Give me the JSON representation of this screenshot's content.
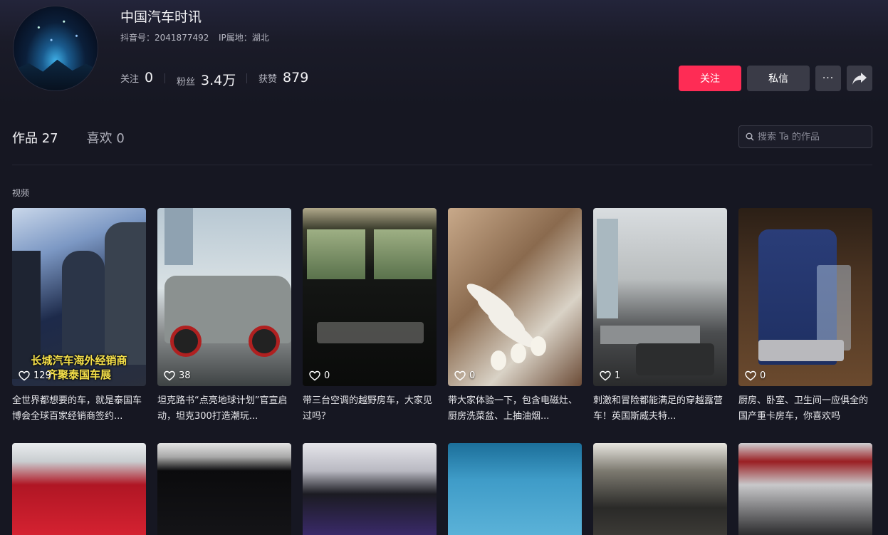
{
  "profile": {
    "name": "中国汽车时讯",
    "douyin_id_label": "抖音号：",
    "douyin_id": "2041877492",
    "ip_label": "IP属地：",
    "ip": "湖北",
    "stats": {
      "following_label": "关注",
      "following": "0",
      "followers_label": "粉丝",
      "followers": "3.4万",
      "likes_label": "获赞",
      "likes": "879"
    }
  },
  "actions": {
    "follow": "关注",
    "message": "私信",
    "more": "···"
  },
  "tabs": [
    {
      "label": "作品 27",
      "active": true
    },
    {
      "label": "喜欢 0",
      "active": false
    }
  ],
  "search": {
    "placeholder": "搜索 Ta 的作品"
  },
  "section_label": "视频",
  "videos": [
    {
      "likes": "129",
      "caption": "全世界都想要的车，就是泰国车博会全球百家经销商签约...",
      "overlay": [
        "长城汽车海外经销商",
        "齐聚泰国车展"
      ]
    },
    {
      "likes": "38",
      "caption": "坦克路书“点亮地球计划”官宣启动，坦克300打造潮玩..."
    },
    {
      "likes": "0",
      "caption": "带三台空调的越野房车，大家见过吗？"
    },
    {
      "likes": "0",
      "caption": "带大家体验一下，包含电磁灶、厨房洗菜盆、上抽油烟..."
    },
    {
      "likes": "1",
      "caption": "刺激和冒险都能满足的穿越露营车！英国斯威夫特..."
    },
    {
      "likes": "0",
      "caption": "厨房、卧室、卫生间一应俱全的国产重卡房车，你喜欢吗"
    }
  ],
  "colors": {
    "background": "#161722",
    "accent": "#fe2c55",
    "button_secondary": "#3a3b47"
  },
  "icons": {
    "search": "search-icon",
    "heart": "heart-icon",
    "share": "share-icon"
  }
}
